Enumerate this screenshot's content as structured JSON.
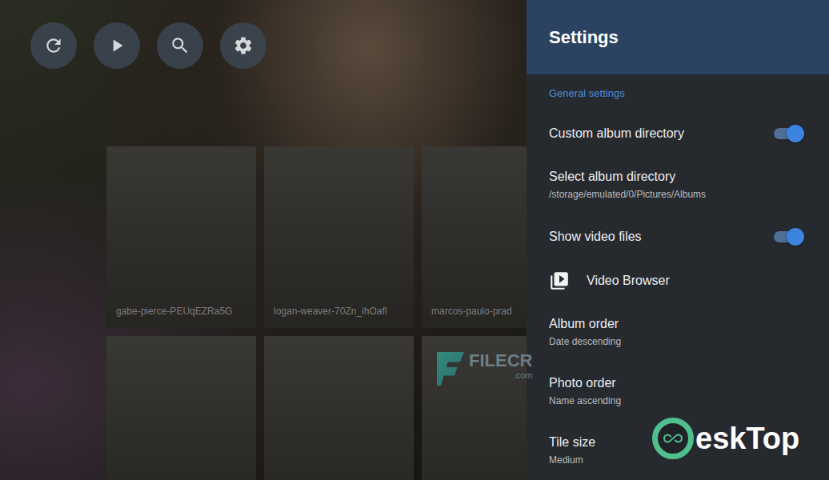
{
  "gallery": {
    "tiles": [
      {
        "caption": "gabe-pierce-PEUqEZRa5G"
      },
      {
        "caption": "logan-weaver-70Zn_ihOafl"
      },
      {
        "caption": "marcos-paulo-prad"
      },
      {},
      {},
      {}
    ]
  },
  "settings": {
    "title": "Settings",
    "section": "General settings",
    "rows": [
      {
        "kind": "toggle",
        "label": "Custom album directory",
        "on": true
      },
      {
        "kind": "detail",
        "label": "Select album directory",
        "value": "/storage/emulated/0/Pictures/Albums"
      },
      {
        "kind": "toggle",
        "label": "Show video files",
        "on": true
      },
      {
        "kind": "link",
        "label": "Video Browser"
      },
      {
        "kind": "detail",
        "label": "Album order",
        "value": "Date descending"
      },
      {
        "kind": "detail",
        "label": "Photo order",
        "value": "Name ascending"
      },
      {
        "kind": "detail",
        "label": "Tile size",
        "value": "Medium"
      }
    ]
  },
  "watermarks": {
    "filecr": "FILECR",
    "filecr_domain": ".com",
    "desktop": "eskTop"
  }
}
